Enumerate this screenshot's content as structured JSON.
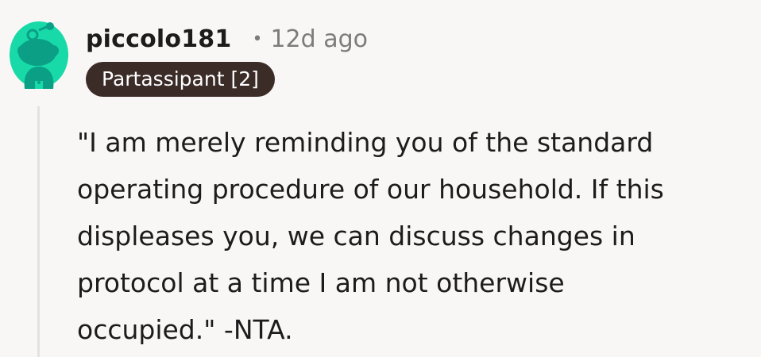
{
  "comment": {
    "author": "piccolo181",
    "separator": "•",
    "time_ago": "12d ago",
    "flair": "Partassipant [2]",
    "body_lines": [
      "\"I am merely reminding you of the standard",
      "operating procedure of our household. If this",
      "displeases you, we can discuss changes in",
      "protocol at a time I am not otherwise",
      "occupied.\" -NTA."
    ],
    "avatar_icon": "snoo-avatar-icon",
    "colors": {
      "avatar_bg": "#18d9a8",
      "avatar_figure": "#0b9f86",
      "flair_bg": "#3b2c28",
      "text": "#1c1c1c",
      "meta": "#7c7c7c"
    }
  }
}
